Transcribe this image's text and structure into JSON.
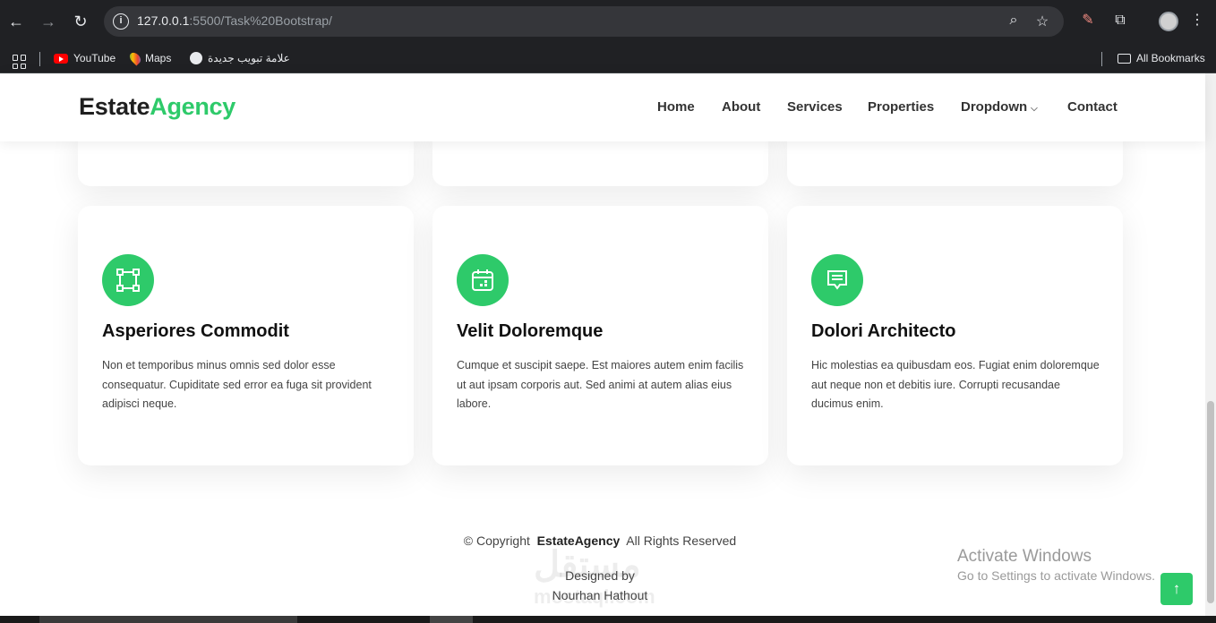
{
  "browser": {
    "url_host": "127.0.0.1",
    "url_rest": ":5500/Task%20Bootstrap/",
    "bookmarks": [
      {
        "label": "YouTube",
        "icon": "youtube-icon"
      },
      {
        "label": "Maps",
        "icon": "maps-icon"
      },
      {
        "label": "علامة تبويب جديدة",
        "icon": "globe-icon"
      }
    ],
    "all_bookmarks": "All Bookmarks"
  },
  "header": {
    "logo_main": "Estate",
    "logo_accent": "Agency",
    "nav": [
      "Home",
      "About",
      "Services",
      "Properties",
      "Dropdown",
      "Contact"
    ]
  },
  "services": [
    {
      "title": "Asperiores Commodit",
      "text": "Non et temporibus minus omnis sed dolor esse consequatur. Cupiditate sed error ea fuga sit provident adipisci neque.",
      "icon": "bounding-box-icon"
    },
    {
      "title": "Velit Doloremque",
      "text": "Cumque et suscipit saepe. Est maiores autem enim facilis ut aut ipsam corporis aut. Sed animi at autem alias eius labore.",
      "icon": "calendar-icon"
    },
    {
      "title": "Dolori Architecto",
      "text": "Hic molestias ea quibusdam eos. Fugiat enim doloremque aut neque non et debitis iure. Corrupti recusandae ducimus enim.",
      "icon": "chat-icon"
    }
  ],
  "footer": {
    "copyright_prefix": "© Copyright",
    "brand": "EstateAgency",
    "copyright_suffix": "All Rights Reserved",
    "designed_by": "Designed by",
    "designer": "Nourhan Hathout"
  },
  "watermark": {
    "arabic": "مستقل",
    "latin": "mostaql.com"
  },
  "activate": {
    "title": "Activate Windows",
    "subtitle": "Go to Settings to activate Windows."
  },
  "colors": {
    "accent": "#2eca6a",
    "chrome": "#202124"
  }
}
